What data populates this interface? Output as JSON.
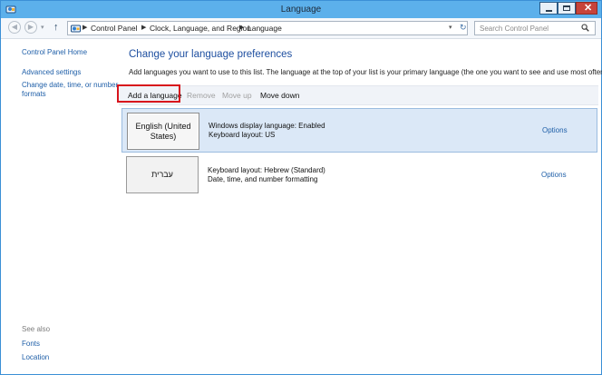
{
  "window": {
    "title": "Language"
  },
  "address": {
    "crumbs": [
      "Control Panel",
      "Clock, Language, and Region",
      "Language"
    ],
    "search_placeholder": "Search Control Panel"
  },
  "left_nav": {
    "links": [
      "Control Panel Home",
      "Advanced settings",
      "Change date, time, or number",
      "formats"
    ],
    "see_also_label": "See also",
    "see_also_links": [
      "Fonts",
      "Location"
    ]
  },
  "main": {
    "heading": "Change your language preferences",
    "intro": "Add languages you want to use to this list. The language at the top of your list is your primary language (the one you want to see and use most often).",
    "toolbar": {
      "add": "Add a language",
      "remove": "Remove",
      "move_up": "Move up",
      "move_down": "Move down"
    },
    "languages": [
      {
        "name": "English (United States)",
        "info_1": "Windows display language: Enabled",
        "info_2": "Keyboard layout: US",
        "options": "Options",
        "selected": true
      },
      {
        "name": "עברית",
        "info_1": "Keyboard layout: Hebrew (Standard)",
        "info_2": "Date, time, and number formatting",
        "options": "Options",
        "selected": false
      }
    ]
  },
  "colors": {
    "accent": "#5cb0eb",
    "link": "#1f5fa8",
    "highlight": "#d8141c"
  },
  "icons": [
    "control-panel-icon",
    "back-icon",
    "forward-icon",
    "up-arrow-icon",
    "refresh-icon",
    "search-icon",
    "minimize-icon",
    "maximize-icon",
    "close-icon"
  ]
}
